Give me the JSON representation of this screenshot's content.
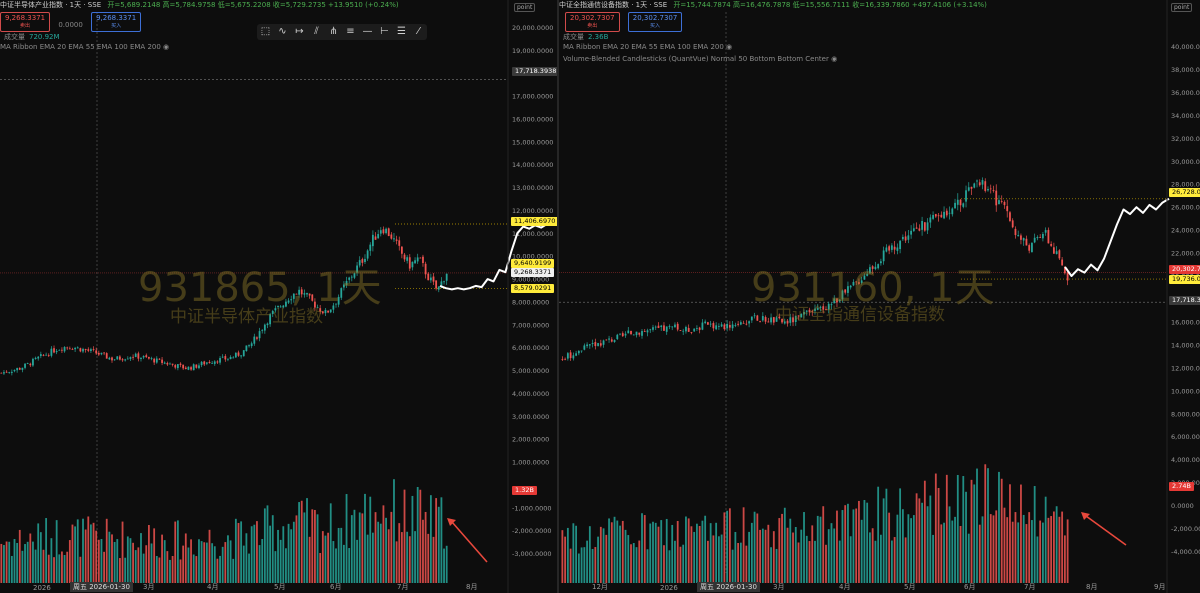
{
  "left": {
    "title": "中证半导体产业指数 · 1天 · SSE",
    "ohlc": "开=5,689.2148  高=5,784.9758  低=5,675.2208  收=5,729.2735  +13.9510 (+0.24%)",
    "sell_price": "9,268.3371",
    "sell_label": "卖出",
    "mid": "0.0000",
    "buy_price": "9,268.3371",
    "buy_label": "买入",
    "volume_label": "成交量",
    "volume_value": "720.92M",
    "ma_label": "MA Ribbon EMA 20 EMA 55 EMA 100 EMA 200",
    "watermark_code": "931865, 1天",
    "watermark_name": "中证半导体产业指数",
    "unit": "point",
    "axis_ticks": [
      "20,000.0000",
      "19,000.0000",
      "18,000.0000",
      "17,000.0000",
      "16,000.0000",
      "15,000.0000",
      "14,000.0000",
      "13,000.0000",
      "12,000.0000",
      "11,000.0000",
      "10,000.0000",
      "9,000.0000",
      "8,000.0000",
      "7,000.0000",
      "6,000.0000",
      "5,000.0000",
      "4,000.0000",
      "3,000.0000",
      "2,000.0000",
      "1,000.0000",
      "-1,000.0000",
      "-2,000.0000",
      "-3,000.0000"
    ],
    "tags": {
      "crosshair": "17,718.3938",
      "high": "11,406.6970",
      "p1": "9,640.9199",
      "last": "9,268.3371",
      "low": "8,579.0291",
      "volume": "1.32B"
    },
    "x_labels": [
      "2026",
      "周五 2026-01-30",
      "3月",
      "4月",
      "5月",
      "6月",
      "7月",
      "8月"
    ]
  },
  "right": {
    "title": "中证全指通信设备指数 · 1天 · SSE",
    "ohlc": "开=15,744.7874  高=16,476.7878  低=15,556.7111  收=16,339.7860  +497.4106 (+3.14%)",
    "sell_price": "20,302.7307",
    "sell_label": "卖出",
    "buy_price": "20,302.7307",
    "buy_label": "买入",
    "volume_label": "成交量",
    "volume_value": "2.36B",
    "ma_label": "MA Ribbon EMA 20 EMA 55 EMA 100 EMA 200",
    "vbc_label": "Volume-Blended Candlesticks (QuantVue) Normal 50 Bottom Bottom Center",
    "watermark_code": "931160, 1天",
    "watermark_name": "中证全指通信设备指数",
    "unit": "point",
    "axis_ticks": [
      "40,000.0000",
      "38,000.0000",
      "36,000.0000",
      "34,000.0000",
      "32,000.0000",
      "30,000.0000",
      "28,000.0000",
      "26,000.0000",
      "24,000.0000",
      "22,000.0000",
      "20,000.0000",
      "18,000.0000",
      "16,000.0000",
      "14,000.0000",
      "12,000.0000",
      "10,000.0000",
      "8,000.0000",
      "6,000.0000",
      "4,000.0000",
      "2,000.0000",
      "0.0000",
      "-2,000.0000",
      "-4,000.0000"
    ],
    "tags": {
      "high": "26,728.0",
      "last": "20,302.7",
      "low": "19,736.0",
      "crosshair": "17,718.3",
      "volume": "2.74B"
    },
    "x_labels": [
      "12月",
      "2026",
      "周五 2026-01-30",
      "3月",
      "4月",
      "5月",
      "6月",
      "7月",
      "8月",
      "9月"
    ]
  },
  "colors": {
    "up": "#26a69a",
    "down": "#ef5350",
    "projection": "#ffffff",
    "arrow": "#e8483c"
  },
  "chart_data": [
    {
      "type": "candlestick",
      "title": "中证半导体产业指数",
      "ylim": [
        -3500,
        20500
      ],
      "price_trend": [
        4900,
        5000,
        5100,
        5300,
        5550,
        5750,
        5950,
        6050,
        6000,
        5900,
        5800,
        5650,
        5500,
        5550,
        5650,
        5600,
        5500,
        5400,
        5300,
        5200,
        5100,
        5200,
        5350,
        5450,
        5500,
        5600,
        5800,
        6200,
        6800,
        7400,
        7800,
        8200,
        8500,
        8200,
        7800,
        7500,
        8000,
        8700,
        9300,
        9900,
        10700,
        11300,
        10900,
        10200,
        9600,
        9900,
        9100,
        8500,
        9300
      ],
      "high_level": 11406.697,
      "last": 9268.3371,
      "low_level": 8579.0291,
      "projection": [
        8700,
        8600,
        8550,
        8600,
        8550,
        8600,
        8700,
        8650,
        9000,
        8900,
        9400,
        9300,
        10200,
        11000,
        11300,
        11200,
        11350,
        11250,
        11406
      ]
    },
    {
      "type": "candlestick",
      "title": "中证全指通信设备指数",
      "ylim": [
        -5000,
        41000
      ],
      "price_trend": [
        12800,
        13300,
        13800,
        14200,
        14500,
        14800,
        15200,
        15300,
        15400,
        15500,
        15300,
        15600,
        15800,
        15600,
        15900,
        16100,
        16300,
        16200,
        16000,
        16300,
        16700,
        17200,
        17800,
        18600,
        19600,
        20800,
        21800,
        22800,
        23600,
        24200,
        24800,
        25600,
        26400,
        27200,
        28000,
        27000,
        25500,
        23500,
        22500,
        24000,
        22000,
        20000
      ],
      "high_level": 26728.0,
      "last": 20302.7,
      "low_level": 19736.0,
      "projection": [
        20800,
        20000,
        20600,
        20300,
        21000,
        20500,
        21500,
        23000,
        24500,
        25800,
        25400,
        26000,
        25500,
        26200,
        25800,
        26400,
        26728
      ]
    }
  ]
}
